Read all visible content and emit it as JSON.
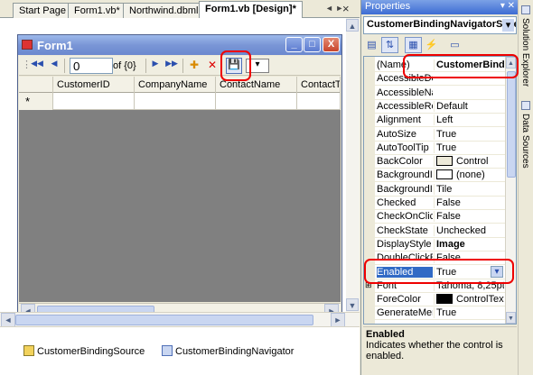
{
  "tabs": [
    {
      "label": "Start Page",
      "active": false
    },
    {
      "label": "Form1.vb*",
      "active": false
    },
    {
      "label": "Northwind.dbml",
      "active": false
    },
    {
      "label": "Form1.vb [Design]*",
      "active": true
    }
  ],
  "tab_nav_glyph": "◄ ►",
  "tab_close_glyph": "×",
  "form": {
    "title": "Form1",
    "minimize_glyph": "_",
    "maximize_glyph": "□",
    "close_glyph": "X"
  },
  "navigator": {
    "first_glyph": "◀◀",
    "prev_glyph": "◀",
    "position_value": "0",
    "count_label": "of {0}",
    "next_glyph": "▶",
    "last_glyph": "▶▶",
    "add_glyph": "✚",
    "delete_glyph": "✕",
    "save_glyph": "💾",
    "dropdown_glyph": "▾"
  },
  "grid": {
    "columns": [
      "CustomerID",
      "CompanyName",
      "ContactName",
      "ContactTi"
    ],
    "new_row_marker": "*"
  },
  "tray": {
    "items": [
      "CustomerBindingSource",
      "CustomerBindingNavigator"
    ]
  },
  "properties": {
    "title": "Properties",
    "title_controls": "▾ ✕",
    "object_selector": "CustomerBindingNavigatorSave",
    "object_selector_arrow": "▾",
    "toolbar": [
      "▤",
      "⇅",
      "▦",
      "⚡",
      "▭"
    ],
    "rows": [
      {
        "name": "(Name)",
        "value": "CustomerBindi",
        "bold": true
      },
      {
        "name": "AccessibleDe",
        "value": ""
      },
      {
        "name": "AccessibleNa",
        "value": ""
      },
      {
        "name": "AccessibleRol",
        "value": "Default"
      },
      {
        "name": "Alignment",
        "value": "Left"
      },
      {
        "name": "AutoSize",
        "value": "True"
      },
      {
        "name": "AutoToolTip",
        "value": "True"
      },
      {
        "name": "BackColor",
        "value": "Control",
        "swatch": "#ece9d8"
      },
      {
        "name": "BackgroundIn",
        "value": "(none)",
        "swatch": "#ffffff"
      },
      {
        "name": "BackgroundIn",
        "value": "Tile"
      },
      {
        "name": "Checked",
        "value": "False"
      },
      {
        "name": "CheckOnClick",
        "value": "False"
      },
      {
        "name": "CheckState",
        "value": "Unchecked"
      },
      {
        "name": "DisplayStyle",
        "value": "Image",
        "bold": true
      },
      {
        "name": "DoubleClickEn",
        "value": "False"
      },
      {
        "name": "Enabled",
        "value": "True",
        "selected": true
      },
      {
        "name": "Font",
        "value": "Tahoma, 8,25pt",
        "expand": "⊞"
      },
      {
        "name": "ForeColor",
        "value": "ControlText",
        "swatch": "#000000"
      },
      {
        "name": "GenerateMem",
        "value": "True"
      }
    ],
    "enabled_dropdown_glyph": "▾",
    "description": {
      "title": "Enabled",
      "text": "Indicates whether the control is enabled."
    }
  },
  "side_tabs": [
    "Solution Explorer",
    "Data Sources"
  ],
  "colors": {
    "highlight": "#e00000",
    "selection": "#316ac5",
    "grid_background": "#808080"
  }
}
